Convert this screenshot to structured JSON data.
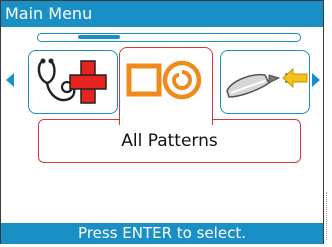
{
  "window": {
    "title": "Main Menu"
  },
  "carousel": {
    "items": [
      {
        "icon": "stethoscope-medical-cross-icon"
      },
      {
        "icon": "square-circle-spiral-patterns-icon"
      },
      {
        "icon": "stylus-arrow-icon"
      }
    ],
    "selected_label": "All Patterns",
    "scroll_position": 0.2
  },
  "status": {
    "hint": "Press ENTER to select."
  },
  "colors": {
    "accent": "#1a8fc6",
    "highlight": "#d8383a",
    "icon_orange": "#f08a1c",
    "icon_red": "#e52420",
    "icon_yellow": "#f6c21a"
  }
}
